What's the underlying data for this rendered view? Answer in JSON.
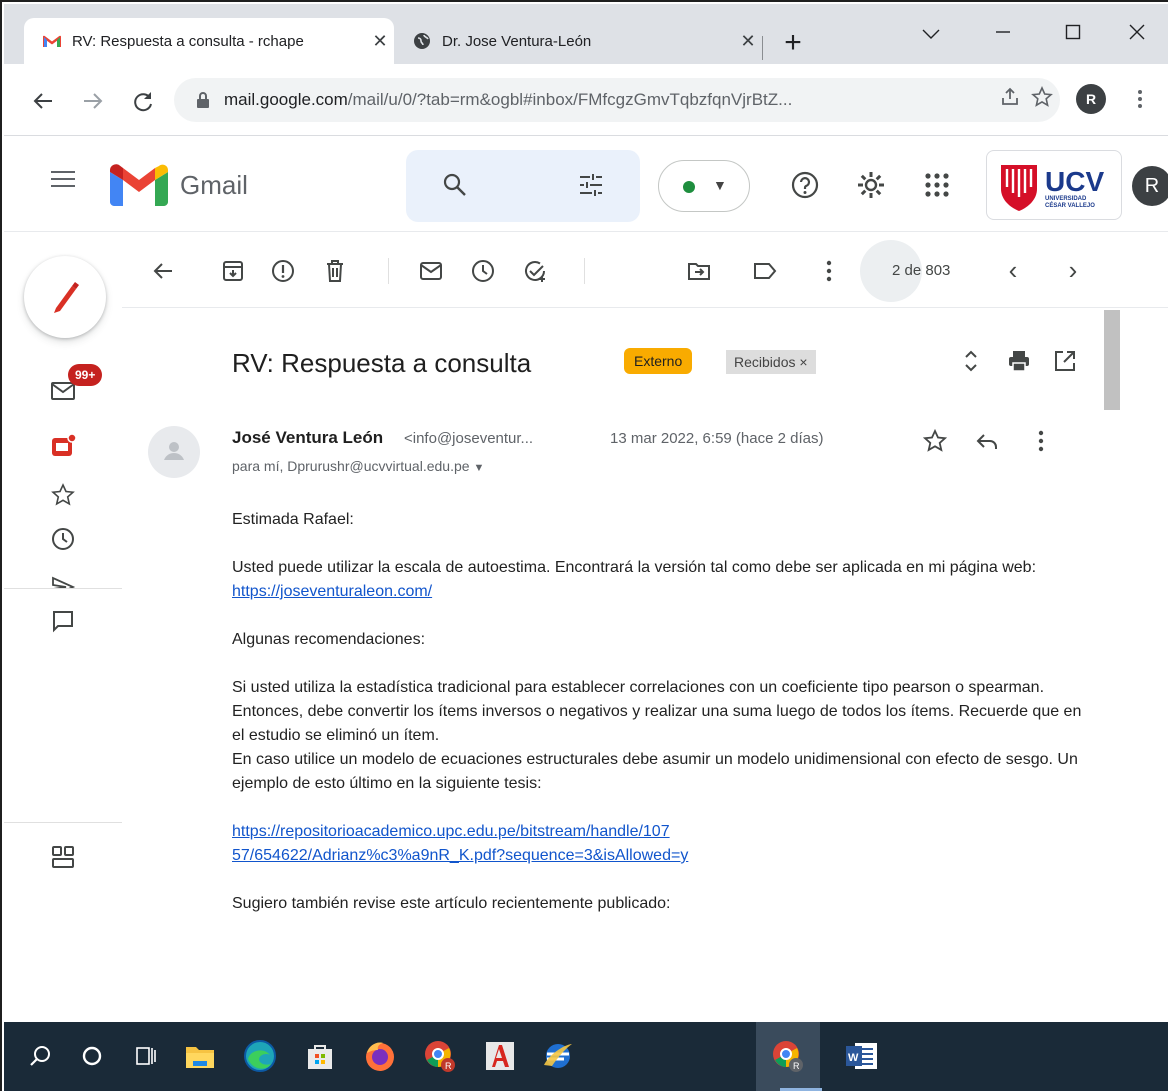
{
  "browser": {
    "tabs": [
      {
        "title": "RV: Respuesta a consulta - rchape",
        "close": "✕",
        "active": true
      },
      {
        "title": "Dr. Jose Ventura-León",
        "close": "✕",
        "active": false
      }
    ],
    "new_tab": "+",
    "address": {
      "host": "mail.google.com",
      "path": "/mail/u/0/?tab=rm&ogbl#inbox/FMfcgzGmvTqbzfqnVjrBtZ..."
    },
    "profile_initial": "R"
  },
  "gmail": {
    "app_name": "Gmail",
    "account_initial": "R",
    "org_logo": {
      "name": "UCV",
      "subtitle_1": "UNIVERSIDAD",
      "subtitle_2": "CÉSAR VALLEJO"
    },
    "brand_colors": {
      "red": "#ea4335",
      "blue": "#4285f4",
      "green": "#34a853",
      "yellow": "#fbbc04",
      "ucv_red": "#d50f28",
      "ucv_blue": "#1b3a8c"
    },
    "rail": {
      "mail_badge": "99+"
    },
    "pager": {
      "text": "2 de 803"
    }
  },
  "message": {
    "subject": "RV: Respuesta a consulta",
    "labels": {
      "external": "Externo",
      "inbox": "Recibidos ×"
    },
    "sender_name": "José Ventura León",
    "sender_email": "<info@joseventur...",
    "date": "13 mar 2022, 6:59 (hace 2 días)",
    "recipients": "para mí, Dprurushr@ucvvirtual.edu.pe",
    "body": {
      "greeting": "Estimada Rafael:",
      "p1_text": "Usted puede utilizar la escala de autoestima. Encontrará la versión tal como debe ser aplicada en mi página web: ",
      "p1_link": "https://joseventuraleon.com/",
      "p2": "Algunas recomendaciones:",
      "p3_line1": "Si usted utiliza la estadística tradicional para establecer correlaciones con un coeficiente tipo pearson o spearman. Entonces, debe convertir los ítems inversos o negativos y realizar una suma luego de todos los ítems. Recuerde que en el estudio se eliminó un ítem.",
      "p3_line2": "En caso utilice un modelo de ecuaciones estructurales debe asumir un modelo unidimensional con efecto de sesgo. Un ejemplo de esto último en la siguiente tesis:",
      "link2_part1": "https://repositorioacademico.upc.edu.pe/bitstream/handle/107",
      "link2_part2": "57/654622/Adrianz%c3%a9nR_K.pdf?sequence=3&isAllowed=y",
      "p4": "Sugiero también revise este artículo recientemente publicado:"
    }
  }
}
